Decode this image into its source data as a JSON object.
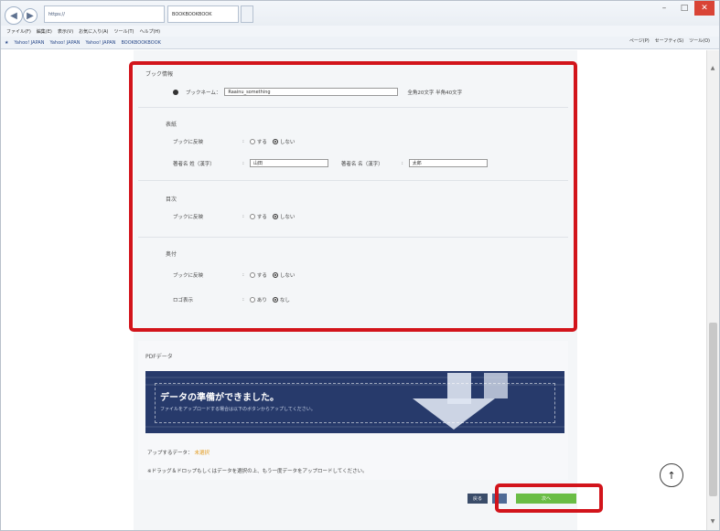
{
  "browser": {
    "url": "https://",
    "tabs": [
      "BOOKBOOKBOOK",
      ""
    ],
    "menu": [
      "ファイル(F)",
      "編集(E)",
      "表示(V)",
      "お気に入り(A)",
      "ツール(T)",
      "ヘルプ(H)"
    ],
    "favorites": [
      "Yahoo! JAPAN",
      "Yahoo! JAPAN",
      "Yahoo! JAPAN",
      "BOOKBOOKBOOK"
    ],
    "toolbar_right": [
      "ページ(P)",
      "セーフティ(S)",
      "ツール(O)"
    ]
  },
  "form": {
    "book_info": {
      "title": "ブック情報",
      "book_name_label": "ブックネーム：",
      "book_name_value": "Raainu_something",
      "note": "全角20文字 半角40文字"
    },
    "cover": {
      "title": "表紙",
      "setting_label": "ブックに反映",
      "opt_yes": "する",
      "opt_no": "しない",
      "author_last_label": "著者名 姓（漢字）",
      "author_last_value": "山田",
      "author_first_label": "著者名 名（漢字）",
      "author_first_value": "太郎"
    },
    "toc": {
      "title": "目次",
      "setting_label": "ブックに反映",
      "opt_yes": "する",
      "opt_no": "しない"
    },
    "back": {
      "title": "奥付",
      "setting_label": "ブックに反映",
      "opt_yes": "する",
      "opt_no": "しない",
      "logo_label": "ロゴ表示",
      "logo_yes": "あり",
      "logo_no": "なし"
    }
  },
  "upload": {
    "title": "PDFデータ",
    "banner_title": "データの準備ができました。",
    "banner_sub": "ファイルをアップロードする場合は以下のボタンからアップしてください。",
    "status_label": "アップするデータ：",
    "status_value": "未選択",
    "note": "※ドラッグ＆ドロップもしくはデータを選択の上、もう一度データをアップロードしてください。"
  },
  "buttons": {
    "back": "戻る",
    "next": "次へ"
  },
  "colors": {
    "highlight": "#d2141b",
    "banner": "#273a6b",
    "next_button": "#6abd45"
  }
}
